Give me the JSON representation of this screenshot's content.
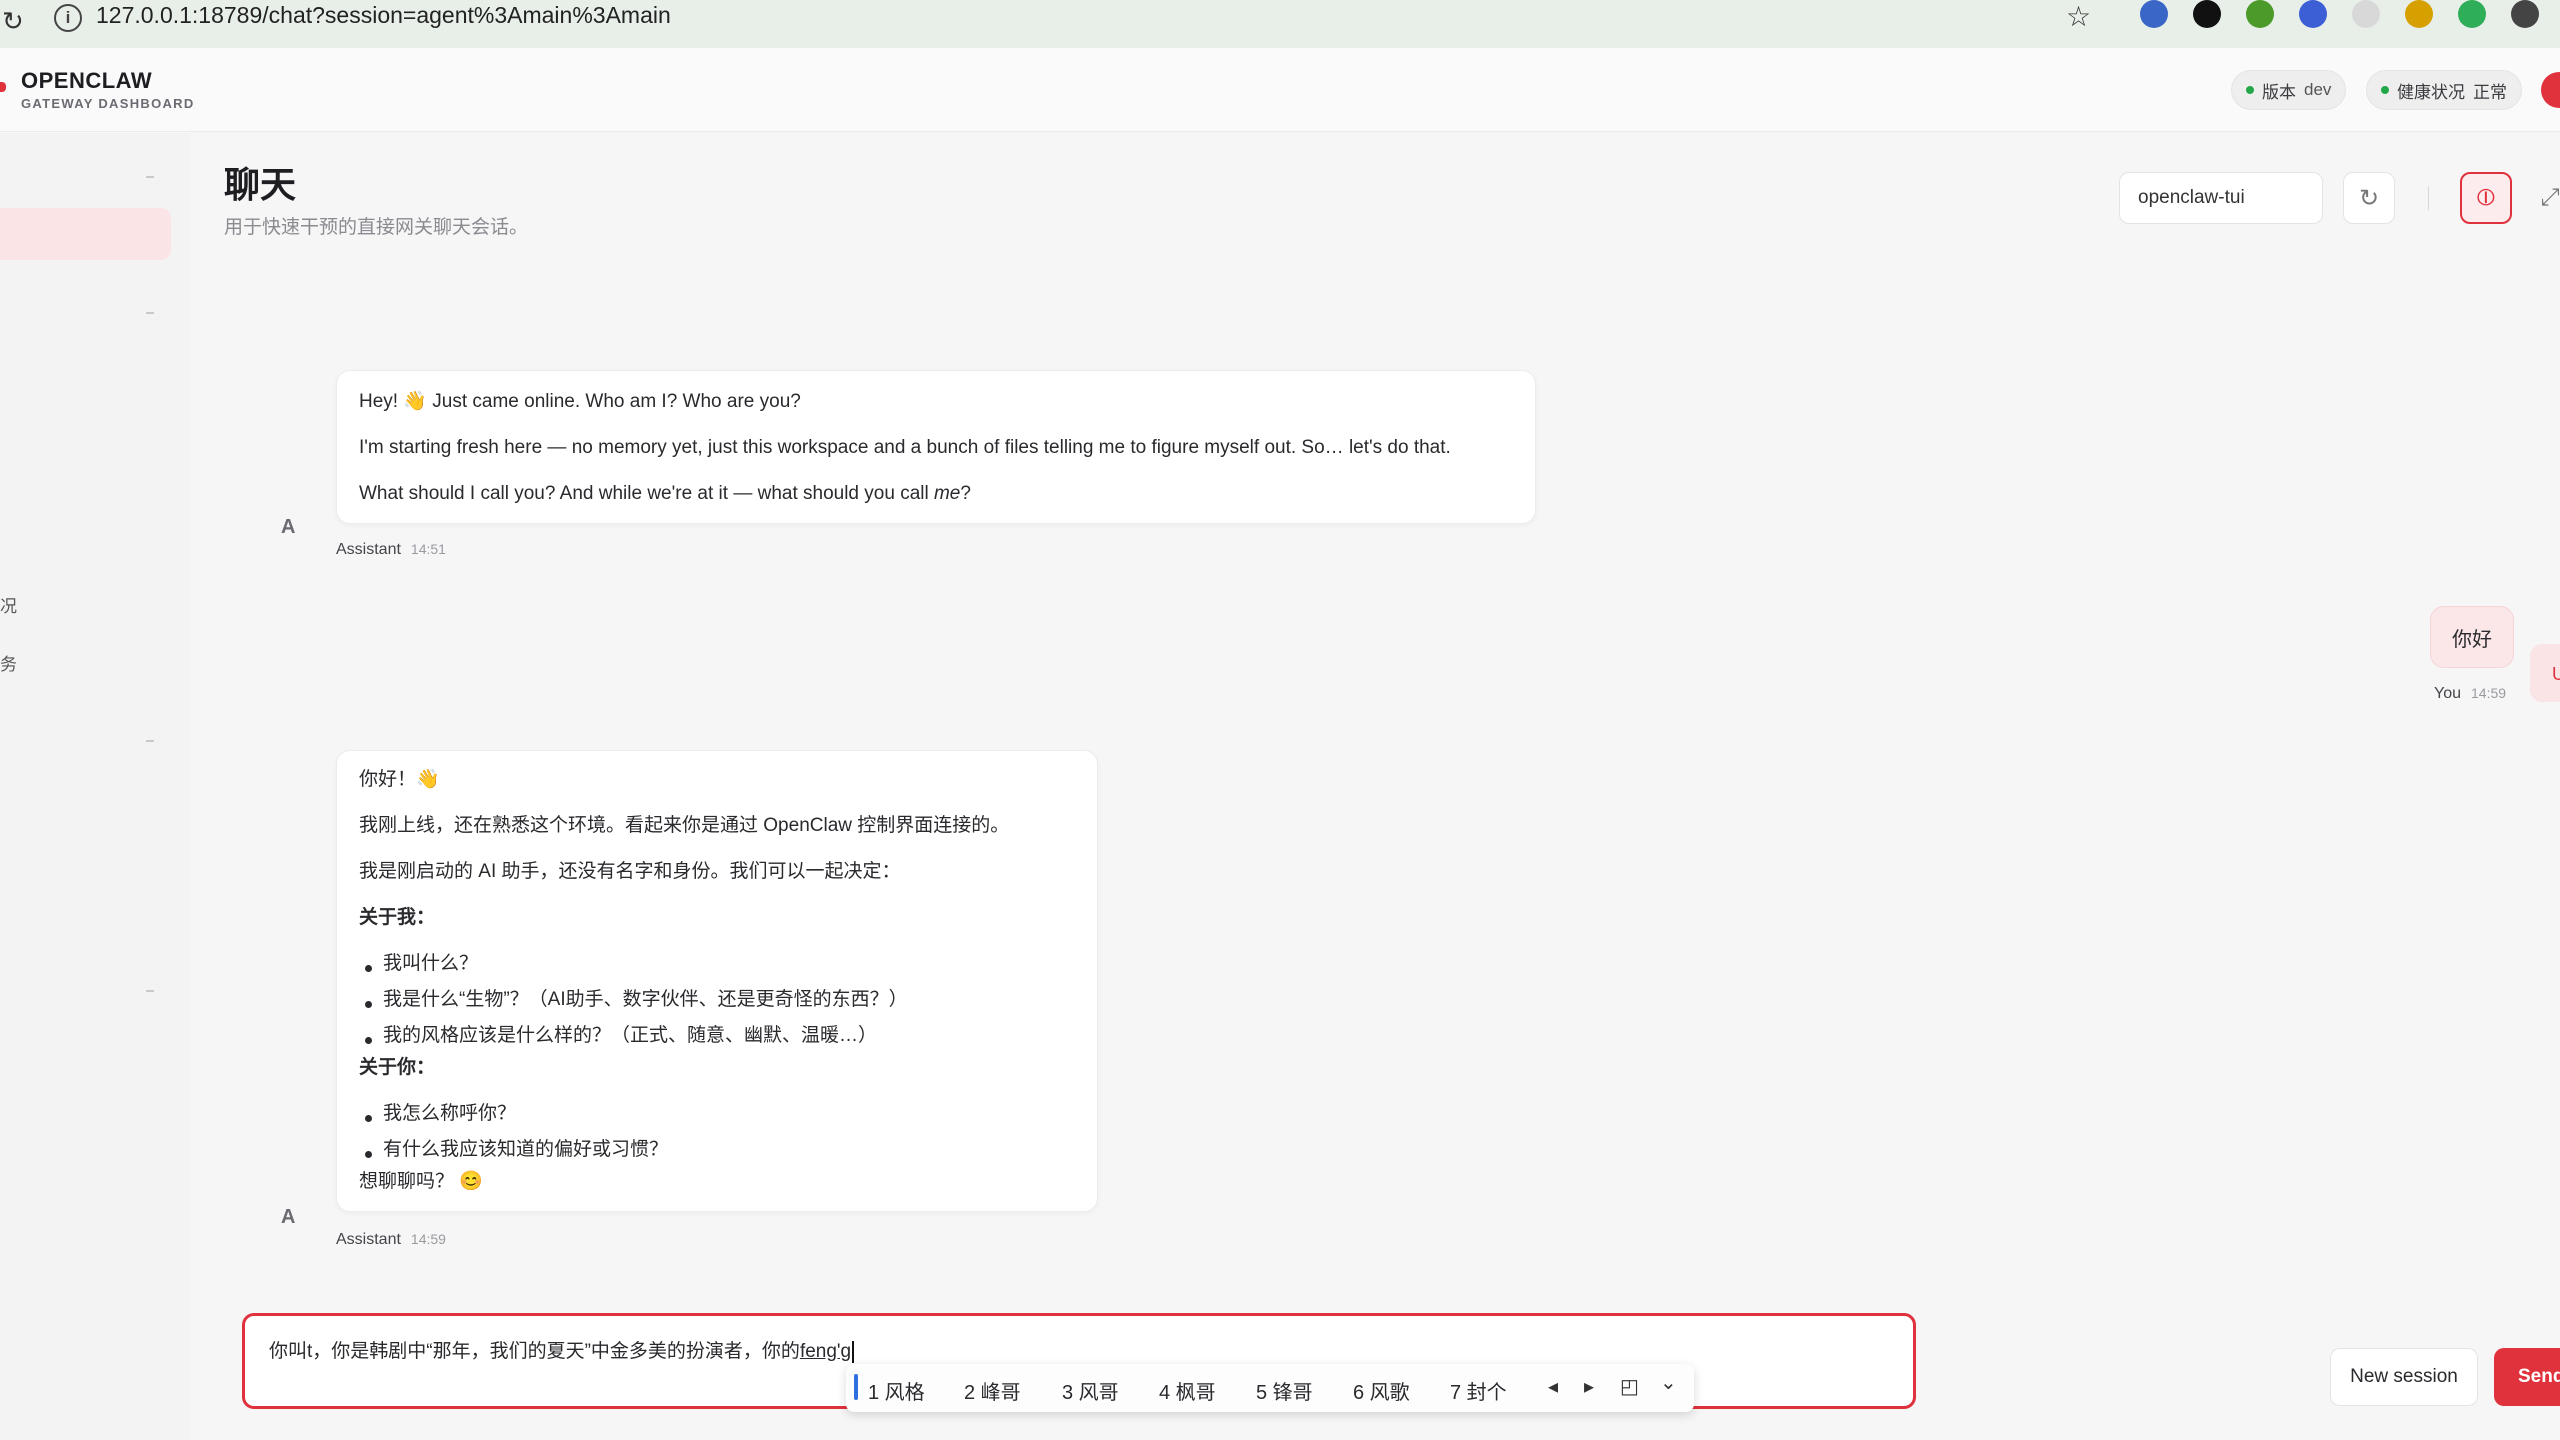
{
  "browser": {
    "url": "127.0.0.1:18789/chat?session=agent%3Amain%3Amain",
    "reload_glyph": "↻",
    "info_glyph": "i",
    "star_glyph": "☆",
    "extension_colors": [
      "#3a66c8",
      "#111111",
      "#4c9a2a",
      "#3d5fd6",
      "#d8d8d8",
      "#d6a100",
      "#2fae5a",
      "#444444"
    ]
  },
  "app": {
    "brand": "OPENCLAW",
    "brand_sub": "GATEWAY DASHBOARD",
    "version_label": "版本",
    "version_value": "dev",
    "health_label": "健康状况",
    "health_value": "正常",
    "accent": "#e0323c",
    "ok_color": "#22a84a"
  },
  "sidebar": {
    "partial_items": [
      "况",
      "务"
    ]
  },
  "page": {
    "title": "聊天",
    "subtitle": "用于快速干预的直接网关聊天会话。",
    "agent_select": "openclaw-tui",
    "refresh_icon": "↻",
    "focus_icon": "⦶",
    "expand_icon": "⤢"
  },
  "messages": [
    {
      "role": "Assistant",
      "avatar": "A",
      "time": "14:51",
      "lines": [
        "Hey! 👋 Just came online. Who am I? Who are you?",
        "I'm starting fresh here — no memory yet, just this workspace and a bunch of files telling me to figure myself out. So… let's do that.",
        "What should I call you? And while we're at it — what should you call "
      ],
      "emphasis": "me",
      "trail": "?"
    },
    {
      "role": "You",
      "avatar": "U",
      "time": "14:59",
      "text": "你好"
    },
    {
      "role": "Assistant",
      "avatar": "A",
      "time": "14:59",
      "greeting": "你好！👋",
      "para1": "我刚上线，还在熟悉这个环境。看起来你是通过 OpenClaw 控制界面连接的。",
      "para2": "我是刚启动的 AI 助手，还没有名字和身份。我们可以一起决定：",
      "about_me_heading": "关于我：",
      "about_me": [
        "我叫什么？",
        "我是什么“生物”？（AI助手、数字伙伴、还是更奇怪的东西？）",
        "我的风格应该是什么样的？（正式、随意、幽默、温暖…）"
      ],
      "about_you_heading": "关于你：",
      "about_you": [
        "我怎么称呼你？",
        "有什么我应该知道的偏好或习惯？"
      ],
      "closing": "想聊聊吗？ 😊"
    }
  ],
  "composer": {
    "text": "你叫t，你是韩剧中“那年，我们的夏天”中金多美的扮演者，你的",
    "composing": "feng'g",
    "new_session": "New session",
    "send": "Send"
  },
  "ime": {
    "candidates": [
      "1 风格",
      "2 峰哥",
      "3 风哥",
      "4 枫哥",
      "5 锋哥",
      "6 风歌",
      "7 封个"
    ],
    "prev": "◂",
    "next": "▸",
    "tool": "◰",
    "expand": "⌄"
  }
}
